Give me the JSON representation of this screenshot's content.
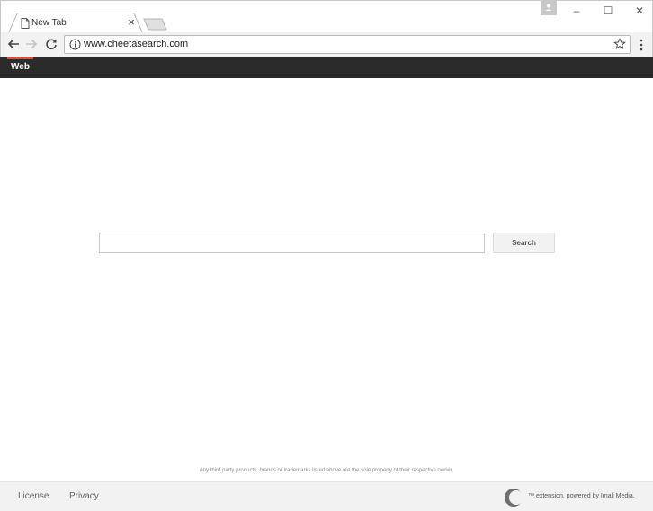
{
  "browser": {
    "tab": {
      "title": "New Tab",
      "close_glyph": "×",
      "favicon": "page-icon"
    },
    "window_controls": {
      "minimize": "–",
      "maximize": "☐",
      "close": "✕"
    },
    "toolbar": {
      "url": "www.cheetasearch.com"
    }
  },
  "site": {
    "nav": {
      "active_tab": "Web",
      "accent_color": "#dd4b39",
      "bar_color": "#2b2b2b"
    },
    "search": {
      "input_value": "",
      "button_label": "Search"
    },
    "disclaimer": "Any third party products, brands or trademarks listed above are the sole property of their respective owner.",
    "footer": {
      "links": [
        "License",
        "Privacy"
      ],
      "powered_by": "™ extension, powered by Imali Media."
    }
  }
}
